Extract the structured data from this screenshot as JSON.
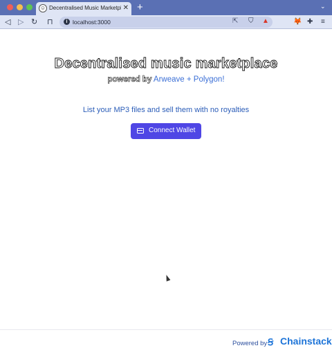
{
  "browser": {
    "tab_title": "Decentralised Music Marketplac",
    "tab_close": "✕",
    "new_tab": "+",
    "tab_menu": "⌄",
    "url": "localhost:3000",
    "toolbar_icons": [
      "back-icon",
      "forward-icon",
      "reload-icon",
      "bookmark-icon",
      "site-info-icon",
      "share-icon",
      "brave-shields-icon",
      "brave-rewards-icon",
      "metamask-icon",
      "extensions-icon",
      "menu-icon"
    ]
  },
  "page": {
    "title": "Decentralised music marketplace",
    "subtitle_prefix": "powered by",
    "subtitle_link": "Arweave + Polygon!",
    "tagline": "List your MP3 files and sell them with no royalties",
    "connect_button": "Connect Wallet",
    "footer_powered": "Powered by",
    "footer_brand": "Chainstack"
  },
  "colors": {
    "tab_bar": "#5a70b4",
    "toolbar": "#dfe5f5",
    "button": "#4f46e5",
    "link": "#3b6fd6",
    "tagline": "#2a5cb8",
    "brand": "#1d74d8"
  }
}
